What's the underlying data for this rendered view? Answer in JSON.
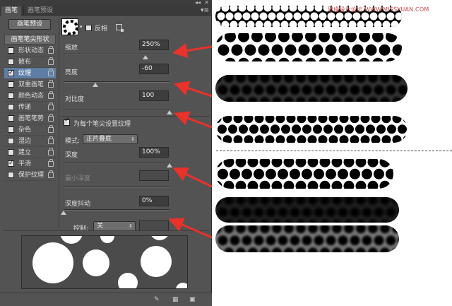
{
  "panel": {
    "tabs": [
      "画笔",
      "画笔预设"
    ],
    "presets_button": "画笔预设",
    "shape_header": "画笔笔尖形状",
    "categories": [
      {
        "label": "形状动态",
        "checked": false,
        "selected": false
      },
      {
        "label": "散布",
        "checked": false,
        "selected": false
      },
      {
        "label": "纹理",
        "checked": true,
        "selected": true
      },
      {
        "label": "双重画笔",
        "checked": false,
        "selected": false
      },
      {
        "label": "颜色动态",
        "checked": false,
        "selected": false
      },
      {
        "label": "传递",
        "checked": false,
        "selected": false
      },
      {
        "label": "画笔笔势",
        "checked": false,
        "selected": false
      },
      {
        "label": "杂色",
        "checked": false,
        "selected": false
      },
      {
        "label": "湿边",
        "checked": false,
        "selected": false
      },
      {
        "label": "建立",
        "checked": false,
        "selected": false
      },
      {
        "label": "平滑",
        "checked": true,
        "selected": false
      },
      {
        "label": "保护纹理",
        "checked": false,
        "selected": false
      }
    ],
    "invert_label": "反相",
    "scale": {
      "label": "缩放",
      "value": "250%"
    },
    "brightness": {
      "label": "亮度",
      "value": "-60"
    },
    "contrast": {
      "label": "对比度",
      "value": "100"
    },
    "each_tip": {
      "label": "为每个笔尖设置纹理",
      "checked": true
    },
    "mode": {
      "label": "模式:",
      "value": "正片叠底"
    },
    "depth": {
      "label": "深度",
      "value": "100%"
    },
    "min_depth": {
      "label": "最小深度",
      "value": ""
    },
    "depth_jitter": {
      "label": "深度抖动",
      "value": "0%"
    },
    "control": {
      "label": "控制:",
      "value": "关"
    }
  },
  "watermark": "思缘设计论坛 WWW.MISSYUAN.COM",
  "icons": [
    "brush-thumbnail-icon",
    "new-preset-icon",
    "lock-icon",
    "toggle-preview-icon",
    "grid-icon",
    "new-brush-icon",
    "panel-menu-icon",
    "collapse-icon",
    "close-icon"
  ]
}
